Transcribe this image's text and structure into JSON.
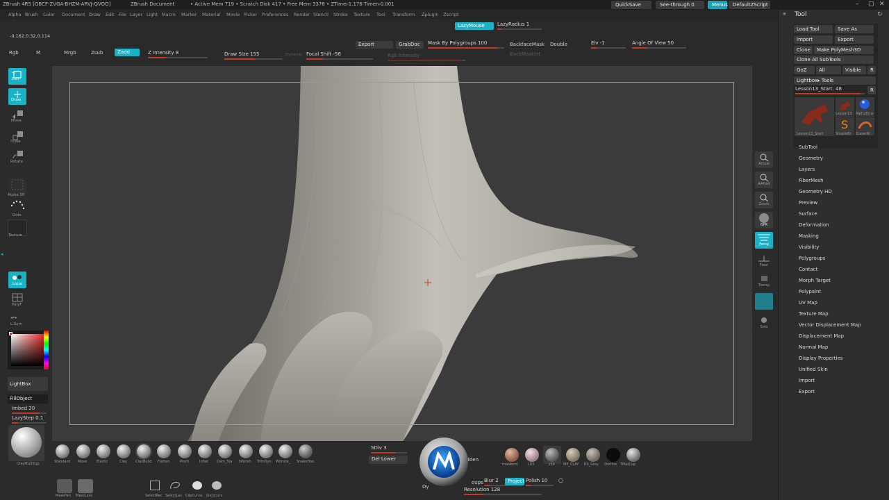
{
  "titlebar": {
    "app": "ZBrush 4R5 [GBCF-ZVGA-BHZM-ARVJ-QVOO]",
    "doc": "ZBrush Document",
    "stats": "• Active Mem 719 • Scratch Disk 417 • Free Mem 3376 • ZTime▹1.176 Timer▹0.001",
    "quicksave": "QuickSave",
    "seethrough": "See-through  0",
    "menus": "Menus",
    "script": "DefaultZScript"
  },
  "menus": [
    "Alpha",
    "Brush",
    "Color",
    "Document",
    "Draw",
    "Edit",
    "File",
    "Layer",
    "Light",
    "Macro",
    "Marker",
    "Material",
    "Movie",
    "Picker",
    "Preferences",
    "Render",
    "Stencil",
    "Stroke",
    "Texture",
    "Tool",
    "Transform",
    "Zplugin",
    "Zscript"
  ],
  "coords": "-0.162,0.32,0.114",
  "top": {
    "lazymouse": "LazyMouse",
    "lazyradius": "LazyRadius 1",
    "export": "Export",
    "grabdoc": "GrabDoc",
    "maskbypolygroups": "Mask By Polygroups 100",
    "backfacemask": "BackfaceMask",
    "double": "Double",
    "backmaskint": "BackMaskInt",
    "elv": "Elv -1",
    "angleofview": "Angle Of View 50",
    "rgb": "Rgb",
    "m": "M",
    "mrgb": "Mrgb",
    "zsub": "Zsub",
    "zadd": "Zadd",
    "zintensity": "Z Intensity 8",
    "drawsize": "Draw Size 155",
    "dynamic": "Dynamic",
    "focalshift": "Focal Shift -56",
    "rgbintensity": "Rgb Intensity"
  },
  "left": {
    "edit": "Edit",
    "draw": "Draw",
    "move": "Move",
    "scale": "Scale",
    "rotate": "Rotate",
    "alpha": "Alpha 50",
    "dots": "Dots",
    "texture": "Texture",
    "local": "Local",
    "polyf": "PolyF",
    "lsym": "L.Sym",
    "lightbox": "LightBox",
    "fillobject": "FillObject",
    "imbed": "Imbed 20",
    "lazystep": "LazyStep 0.1",
    "brush": "ClayBuildup"
  },
  "right": {
    "actual": "Actual",
    "aahalf": "AAHalf",
    "zoom": "Zoom",
    "bpr": "BPR",
    "persp": "Persp",
    "floor": "Floor",
    "transp": "Transp",
    "solo": "Solo"
  },
  "palette": {
    "title": "Tool",
    "loadtool": "Load Tool",
    "saveas": "Save As",
    "import": "Import",
    "export": "Export",
    "clone": "Clone",
    "makepolymesh": "Make PolyMesh3D",
    "cloneall": "Clone  All SubTools",
    "goz": "GoZ",
    "all": "All",
    "visible": "Visible",
    "r": "R",
    "lightboxtools": "Lightbox▸ Tools",
    "lesson": "Lesson13_Start. 48",
    "thumbs": [
      "Lesson13_Start",
      "Lesson13",
      "AlphaBrus",
      "SimpleBr",
      "EraserBr"
    ],
    "items": [
      "SubTool",
      "Geometry",
      "Layers",
      "FiberMesh",
      "Geometry HD",
      "Preview",
      "Surface",
      "Deformation",
      "Masking",
      "Visibility",
      "Polygroups",
      "Contact",
      "Morph Target",
      "Polypaint",
      "UV Map",
      "Texture Map",
      "Vector Displacement Map",
      "Displacement Map",
      "Normal Map",
      "Display Properties",
      "Unified Skin",
      "Import",
      "Export"
    ]
  },
  "bottom": {
    "brushes": [
      "Standard",
      "Move",
      "Elastic",
      "Clay",
      "ClayBuild",
      "Flatten",
      "Pinch",
      "Inflat",
      "Dam_Sta",
      "hPolish",
      "TrimDyn",
      "Wrinkle_",
      "SnakeHoo"
    ],
    "sdiv": "SDiv 3",
    "dellower": "Del Lower",
    "hidden": "hidden",
    "groups": "oups",
    "blur": "Blur 2",
    "project": "Project",
    "polish": "Polish 10",
    "resolution": "Resolution 128",
    "dy": "Dy",
    "materials": [
      "matAerni",
      "L03",
      "z56",
      "MP_CLAY",
      "RS_Grey",
      "Outline",
      "TMatCap"
    ],
    "strokes": [
      "MaskPen",
      "MaskLass"
    ],
    "selects": [
      "SelectRec",
      "SelectLas",
      "ClipCurve",
      "SliceCurv"
    ]
  },
  "colors": {
    "accent": "#1bb1c7",
    "slider": "#c0392b",
    "canvas": "#3b3b3b"
  }
}
